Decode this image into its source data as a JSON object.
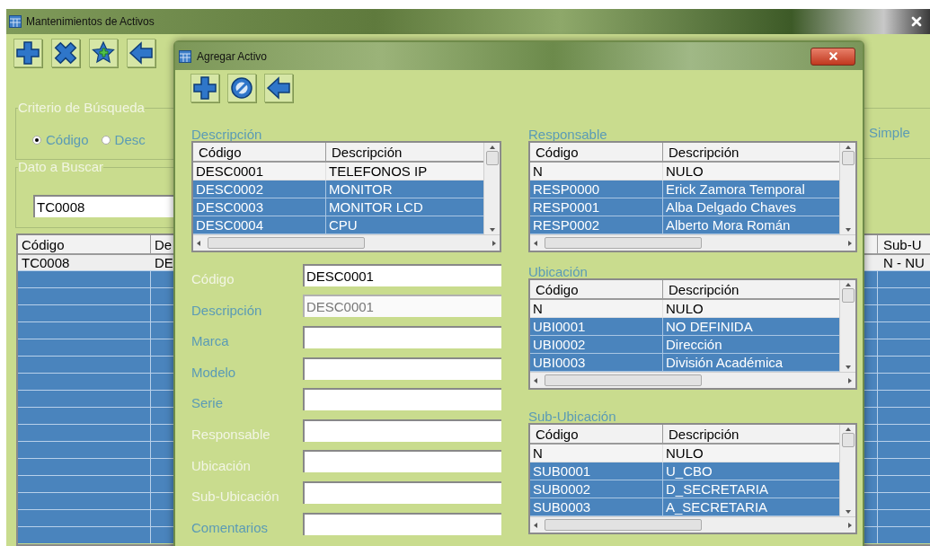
{
  "main_window": {
    "title": "Mantenimientos de Activos",
    "search_criteria": {
      "title": "Criterio de Búsqueda",
      "options": [
        {
          "label": "Código",
          "selected": true
        },
        {
          "label": "Desc",
          "selected": false
        }
      ],
      "right_text": "Simple"
    },
    "search_value": {
      "title": "Dato a Buscar",
      "value": "TC0008"
    },
    "results_table": {
      "left_columns": [
        "Código",
        "De"
      ],
      "right_column": "Sub-U",
      "rows": [
        {
          "left_cells": [
            "TC0008",
            "DE"
          ],
          "right_cell": "N - NU",
          "selected": false
        }
      ]
    }
  },
  "dialog": {
    "title": "Agregar Activo",
    "lookups": [
      {
        "title": "Descripción",
        "columns": [
          "Código",
          "Descripción"
        ],
        "rows": [
          {
            "cells": [
              "DESC0001",
              "TELEFONOS IP"
            ],
            "selected": false
          },
          {
            "cells": [
              "DESC0002",
              "MONITOR"
            ],
            "selected": true
          },
          {
            "cells": [
              "DESC0003",
              "MONITOR LCD"
            ],
            "selected": true
          },
          {
            "cells": [
              "DESC0004",
              "CPU"
            ],
            "selected": true
          }
        ]
      },
      {
        "title": "Responsable",
        "columns": [
          "Código",
          "Descripción"
        ],
        "rows": [
          {
            "cells": [
              "N",
              "NULO"
            ],
            "selected": false
          },
          {
            "cells": [
              "RESP0000",
              "Erick Zamora Temporal"
            ],
            "selected": true
          },
          {
            "cells": [
              "RESP0001",
              "Alba Delgado Chaves"
            ],
            "selected": true
          },
          {
            "cells": [
              "RESP0002",
              "Alberto Mora Román"
            ],
            "selected": true
          }
        ]
      },
      {
        "title": "Ubicación",
        "columns": [
          "Código",
          "Descripción"
        ],
        "rows": [
          {
            "cells": [
              "N",
              "NULO"
            ],
            "selected": false
          },
          {
            "cells": [
              "UBI0001",
              "NO DEFINIDA"
            ],
            "selected": true
          },
          {
            "cells": [
              "UBI0002",
              "Dirección"
            ],
            "selected": true
          },
          {
            "cells": [
              "UBI0003",
              "División Académica"
            ],
            "selected": true
          }
        ]
      },
      {
        "title": "Sub-Ubicación",
        "columns": [
          "Código",
          "Descripción"
        ],
        "rows": [
          {
            "cells": [
              "N",
              "NULO"
            ],
            "selected": false
          },
          {
            "cells": [
              "SUB0001",
              "U_CBO"
            ],
            "selected": true
          },
          {
            "cells": [
              "SUB0002",
              "D_SECRETARIA"
            ],
            "selected": true
          },
          {
            "cells": [
              "SUB0003",
              "A_SECRETARIA"
            ],
            "selected": true
          }
        ]
      }
    ],
    "form": [
      {
        "label": "Código",
        "value": "DESC0001",
        "highlight": true,
        "disabled": false
      },
      {
        "label": "Descripción",
        "value": "DESC0001",
        "highlight": false,
        "disabled": true
      },
      {
        "label": "Marca",
        "highlight": false,
        "disabled": false
      },
      {
        "label": "Modelo",
        "highlight": false,
        "disabled": false
      },
      {
        "label": "Serie",
        "highlight": false,
        "disabled": false
      },
      {
        "label": "Responsable",
        "highlight": true,
        "disabled": false
      },
      {
        "label": "Ubicación",
        "highlight": true,
        "disabled": false
      },
      {
        "label": "Sub-Ubicación",
        "highlight": true,
        "disabled": false
      },
      {
        "label": "Comentarios",
        "highlight": false,
        "disabled": false
      }
    ]
  }
}
